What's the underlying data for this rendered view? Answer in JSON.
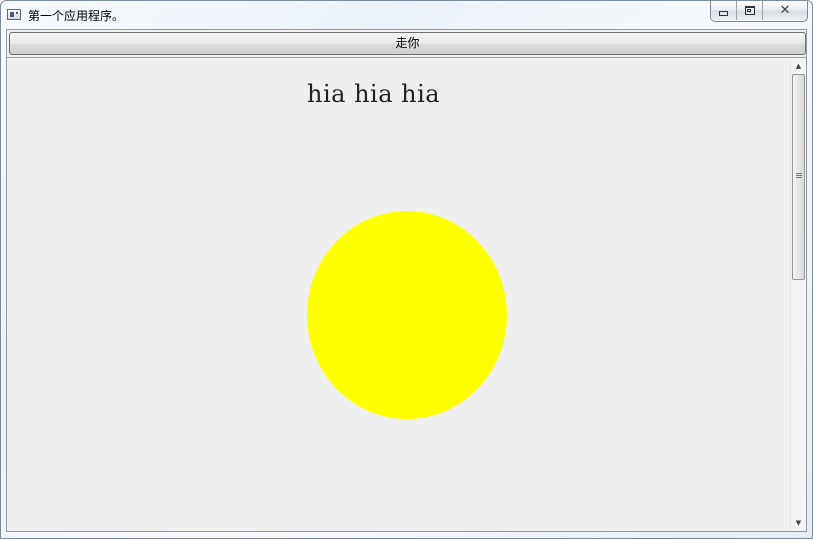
{
  "window": {
    "title": "第一个应用程序。",
    "caption_buttons": {
      "minimize_icon": "minimize-icon",
      "maximize_icon": "maximize-icon",
      "close_glyph": "✕"
    }
  },
  "toolbar": {
    "go_button_label": "走你"
  },
  "canvas": {
    "text": "hia hia hia",
    "circle_color": "#ffff00",
    "background_color": "#efefef"
  },
  "scrollbar": {
    "up_arrow": "▲",
    "down_arrow": "▼"
  }
}
